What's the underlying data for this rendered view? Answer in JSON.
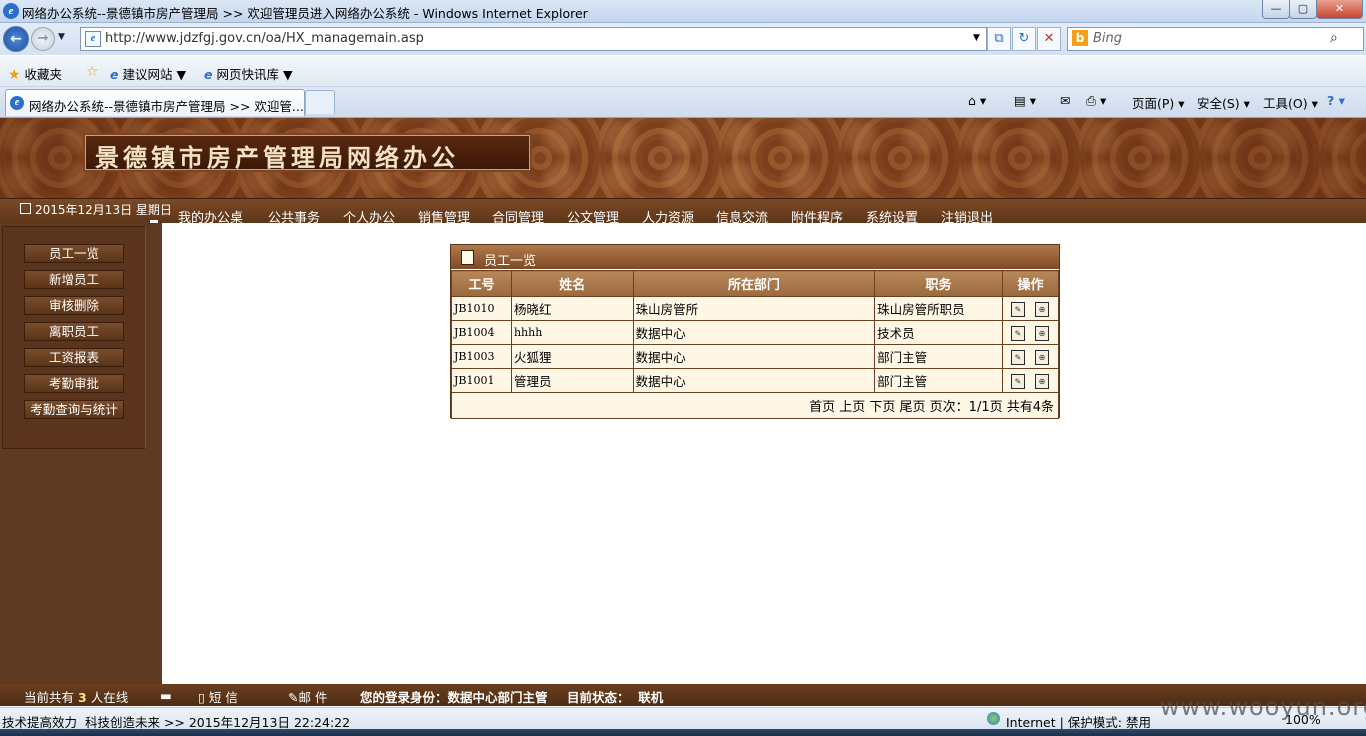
{
  "window": {
    "title": "网络办公系统--景德镇市房产管理局 >> 欢迎管理员进入网络办公系统 - Windows Internet Explorer",
    "min": "—",
    "max": "▢",
    "close": "✕"
  },
  "address": {
    "url": "http://www.jdzfgj.gov.cn/oa/HX_managemain.asp",
    "search_placeholder": "Bing"
  },
  "favorites": {
    "favorites_label": "收藏夹",
    "suggested_sites": "建议网站",
    "web_slices": "网页快讯库"
  },
  "tab": {
    "active_label": "网络办公系统--景德镇市房产管理局 >> 欢迎管..."
  },
  "commands": {
    "page": "页面(P)",
    "safety": "安全(S)",
    "tools": "工具(O)"
  },
  "header": {
    "logo": "景德镇市房产管理局网络办公"
  },
  "menubar": {
    "date": "2015年12月13日 星期日",
    "items": [
      "我的办公桌",
      "公共事务",
      "个人办公",
      "销售管理",
      "合同管理",
      "公文管理",
      "人力资源",
      "信息交流",
      "附件程序",
      "系统设置",
      "注销退出"
    ]
  },
  "sidebar": {
    "items": [
      "员工一览",
      "新增员工",
      "审核删除",
      "离职员工",
      "工资报表",
      "考勤审批",
      "考勤查询与统计"
    ]
  },
  "panel": {
    "title": "员工一览",
    "columns": [
      "工号",
      "姓名",
      "所在部门",
      "职务",
      "操作"
    ],
    "rows": [
      {
        "id": "JB1010",
        "name": "杨晓红",
        "dept": "珠山房管所",
        "title": "珠山房管所职员"
      },
      {
        "id": "JB1004",
        "name": "hhhh",
        "dept": "数据中心",
        "title": "技术员"
      },
      {
        "id": "JB1003",
        "name": "火狐狸",
        "dept": "数据中心",
        "title": "部门主管"
      },
      {
        "id": "JB1001",
        "name": "管理员",
        "dept": "数据中心",
        "title": "部门主管"
      }
    ],
    "pager": "首页 上页 下页 尾页 页次：1/1页 共有4条"
  },
  "bottombar": {
    "online_prefix": "当前共有",
    "online_count": "3",
    "online_suffix": "人在线",
    "sms": "短 信",
    "mail": "邮 件",
    "identity": "您的登录身份：数据中心部门主管",
    "status": "目前状态：  联机"
  },
  "statusbar": {
    "slogan": "技术提高效力  科技创造未来 >> 2015年12月13日 22:24:22",
    "zone": "Internet | 保护模式: 禁用",
    "zoom": "100%",
    "watermark": "www.wooyun.org"
  }
}
